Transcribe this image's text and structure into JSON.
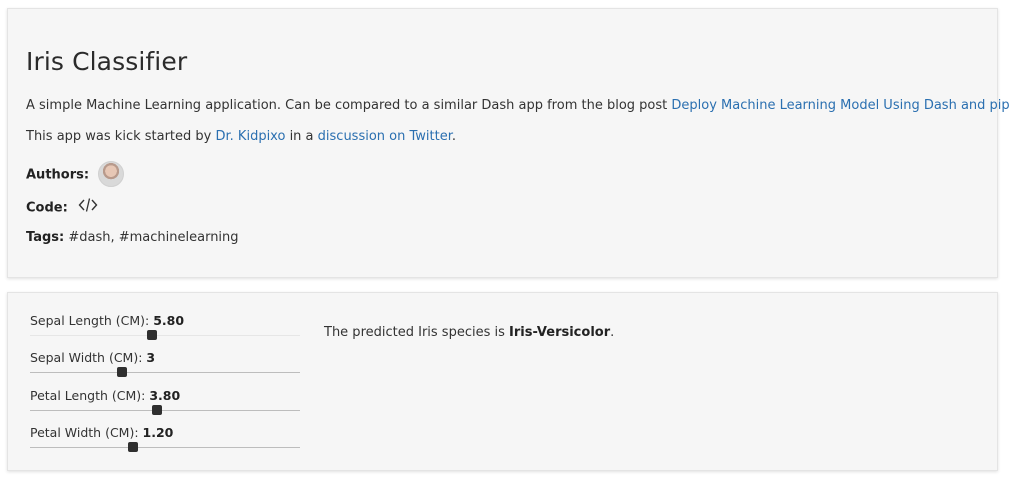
{
  "header": {
    "title": "Iris Classifier",
    "description_prefix": "A simple Machine Learning application. Can be compared to a similar Dash app from the blog post ",
    "description_link": "Deploy Machine Learning Model Using Dash and pipenv",
    "kick_prefix": "This app was kick started by ",
    "kick_link1": "Dr. Kidpixo",
    "kick_middle": " in a ",
    "kick_link2": "discussion on Twitter",
    "kick_suffix": ".",
    "authors_label": "Authors:",
    "code_label": "Code:",
    "code_icon": "code-icon",
    "tags_label": "Tags:",
    "tags_value": " #dash, #machinelearning"
  },
  "controls": {
    "sliders": [
      {
        "label": "Sepal Length (CM): ",
        "value": "5.80",
        "fraction": 0.45
      },
      {
        "label": "Sepal Width (CM): ",
        "value": "3",
        "fraction": 0.34
      },
      {
        "label": "Petal Length (CM): ",
        "value": "3.80",
        "fraction": 0.47
      },
      {
        "label": "Petal Width (CM): ",
        "value": "1.20",
        "fraction": 0.38
      }
    ]
  },
  "prediction": {
    "prefix": "The predicted Iris species is ",
    "species": "Iris-Versicolor",
    "suffix": "."
  },
  "colors": {
    "link": "#2a6fb0",
    "card_background": "#f6f6f6",
    "slider_thumb": "#2f2f2f"
  }
}
